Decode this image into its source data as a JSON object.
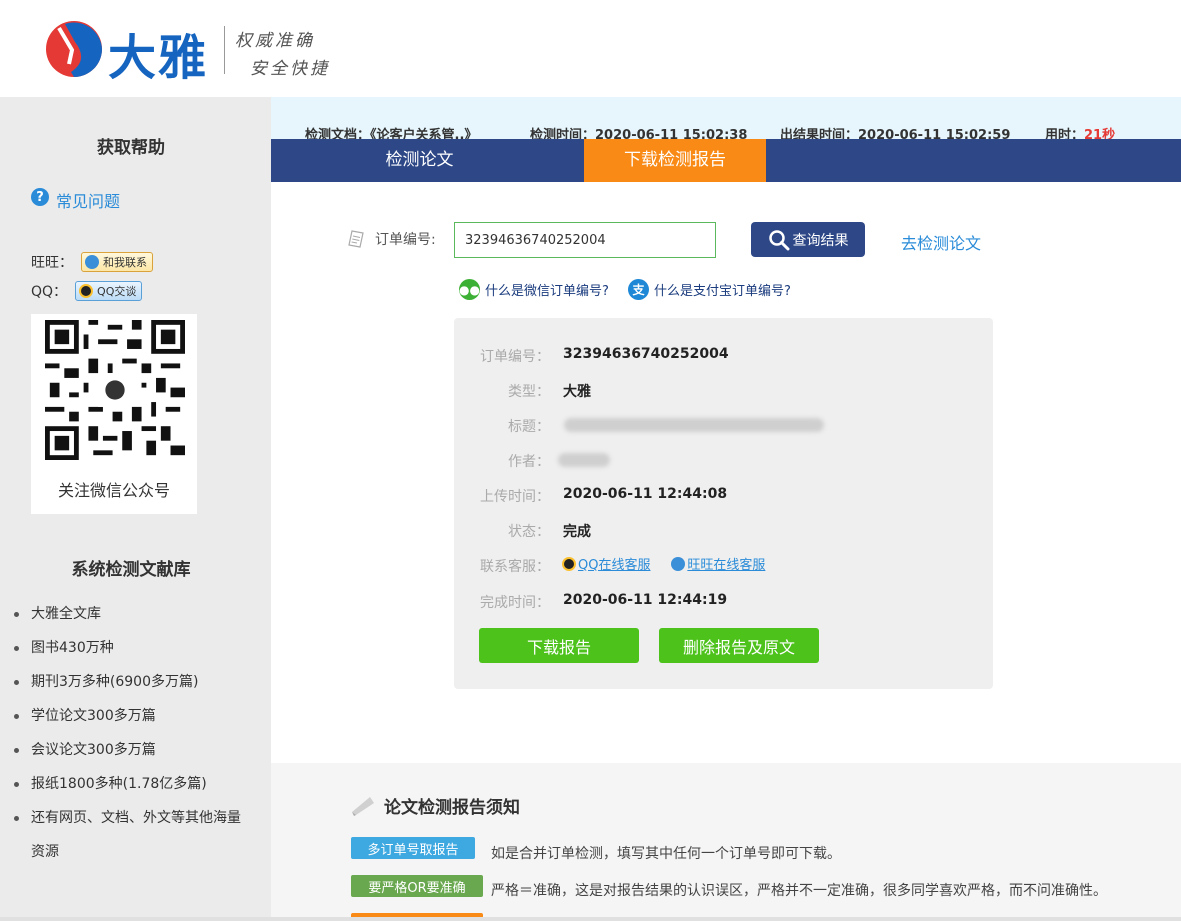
{
  "header": {
    "logo_text": "大雅",
    "slogan_line1": "权威准确",
    "slogan_line2": "安全快捷",
    "colors": {
      "logo_red": "#e53935",
      "logo_blue": "#1565c0"
    }
  },
  "sidebar": {
    "help_title": "获取帮助",
    "faq_label": "常见问题",
    "wangwang_label": "旺旺：",
    "wangwang_button": "和我联系",
    "qq_label": "QQ：",
    "qq_button": "QQ交谈",
    "qr_caption": "关注微信公众号",
    "library_title": "系统检测文献库",
    "library_items": [
      "大雅全文库",
      "图书430万种",
      "期刊3万多种(6900多万篇)",
      "学位论文300多万篇",
      "会议论文300多万篇",
      "报纸1800多种(1.78亿多篇)",
      "还有网页、文档、外文等其他海量资源"
    ]
  },
  "info_bar": {
    "doc_label": "检测文档：",
    "doc_value": "《论客户关系管..》",
    "check_time_label": "检测时间：",
    "check_time_value": "2020-06-11 15:02:38",
    "result_time_label": "出结果时间：",
    "result_time_value": "2020-06-11 15:02:59",
    "duration_label": "用时：",
    "duration_value": "21秒"
  },
  "tabs": [
    {
      "label": "检测论文",
      "active": false
    },
    {
      "label": "下载检测报告",
      "active": true
    }
  ],
  "query": {
    "order_label": "订单编号:",
    "order_value": "32394636740252004",
    "query_button": "查询结果",
    "go_check_link": "去检测论文",
    "wechat_help": "什么是微信订单编号?",
    "alipay_help": "什么是支付宝订单编号?"
  },
  "result": {
    "order_label": "订单编号：",
    "order_value": "32394636740252004",
    "type_label": "类型：",
    "type_value": "大雅",
    "title_label": "标题：",
    "author_label": "作者：",
    "upload_label": "上传时间：",
    "upload_value": "2020-06-11 12:44:08",
    "status_label": "状态：",
    "status_value": "完成",
    "service_label": "联系客服：",
    "qq_service": "QQ在线客服",
    "ww_service": "旺旺在线客服",
    "finish_label": "完成时间：",
    "finish_value": "2020-06-11 12:44:19",
    "download_button": "下载报告",
    "delete_button": "删除报告及原文"
  },
  "notice": {
    "title": "论文检测报告须知",
    "items": [
      {
        "tag": "多订单号取报告",
        "text": "如是合并订单检测，填写其中任何一个订单号即可下载。",
        "color": "#3ea8e0"
      },
      {
        "tag": "要严格OR要准确",
        "text": "严格＝准确，这是对报告结果的认识误区，严格并不一定准确，很多同学喜欢严格，而不问准确性。",
        "color": "#6aa84f"
      }
    ]
  }
}
